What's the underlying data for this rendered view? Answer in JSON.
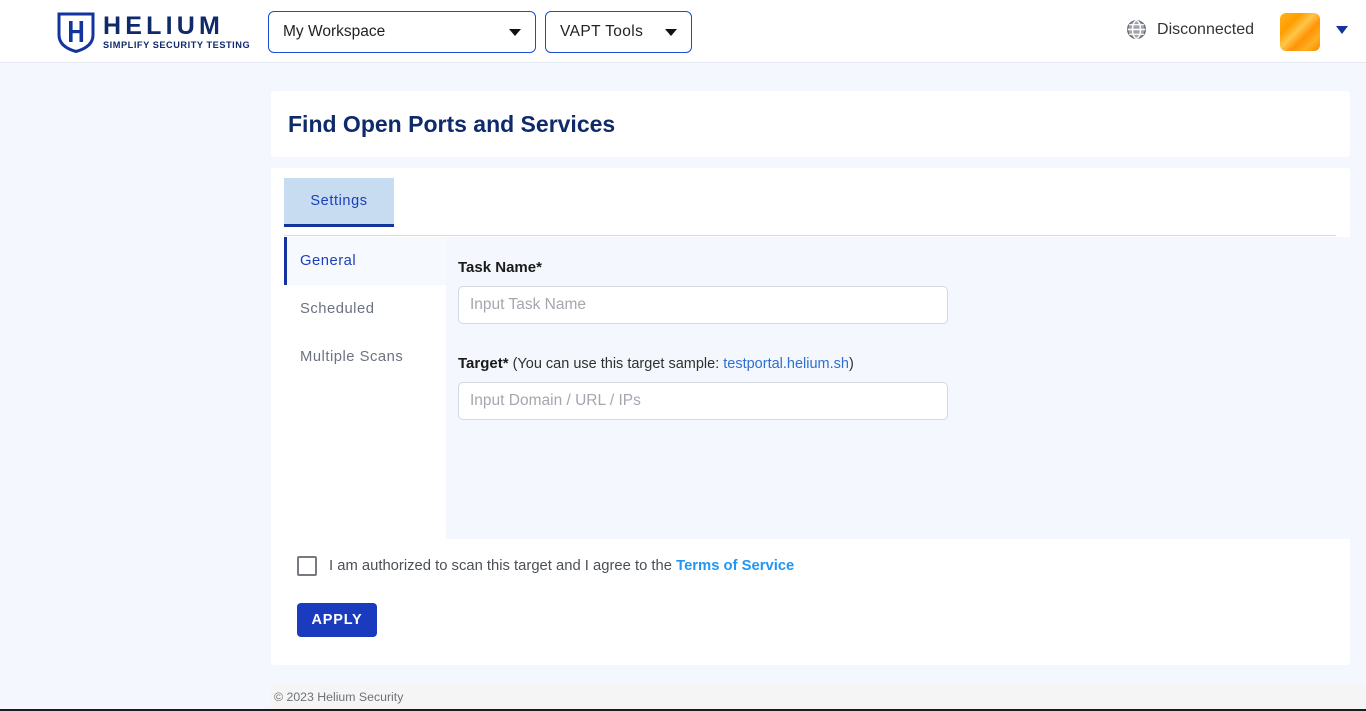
{
  "topbar": {
    "logo": {
      "icon": "shield-h-icon",
      "name": "HELIUM",
      "tagline": "SIMPLIFY SECURITY TESTING"
    },
    "workspace_dropdown": {
      "value": "My Workspace",
      "icon": "chevron-down-icon"
    },
    "tools_dropdown": {
      "value": "VAPT Tools",
      "icon": "chevron-down-icon"
    },
    "connection": {
      "icon": "globe-icon",
      "status": "Disconnected"
    },
    "avatar": {
      "icon": "user-avatar",
      "color": "#ff9d00"
    },
    "avatar_caret_icon": "chevron-down-icon"
  },
  "header": {
    "title": "Find Open Ports and Services"
  },
  "tabs": [
    {
      "label": "Settings",
      "active": true
    }
  ],
  "sidebar": {
    "items": [
      {
        "label": "General",
        "active": true
      },
      {
        "label": "Scheduled",
        "active": false
      },
      {
        "label": "Multiple Scans",
        "active": false
      }
    ]
  },
  "form": {
    "task_name": {
      "label": "Task Name*",
      "value": "",
      "placeholder": "Input Task Name"
    },
    "target": {
      "label": "Target*",
      "hint_prefix": " (You can use this target sample: ",
      "hint_link": "testportal.helium.sh",
      "hint_suffix": ")",
      "value": "",
      "placeholder": "Input Domain / URL / IPs"
    }
  },
  "consent": {
    "checked": false,
    "text": "I am authorized to scan this target and I agree to the ",
    "link": "Terms of Service"
  },
  "actions": {
    "apply_label": "APPLY"
  },
  "footer": {
    "copyright": "© 2023 Helium Security"
  },
  "colors": {
    "brand_navy": "#0f2a6b",
    "accent_blue": "#1a3bbd",
    "link_blue": "#2196f3",
    "page_bg": "#f4f7fd",
    "avatar_orange": "#ff9d00"
  }
}
